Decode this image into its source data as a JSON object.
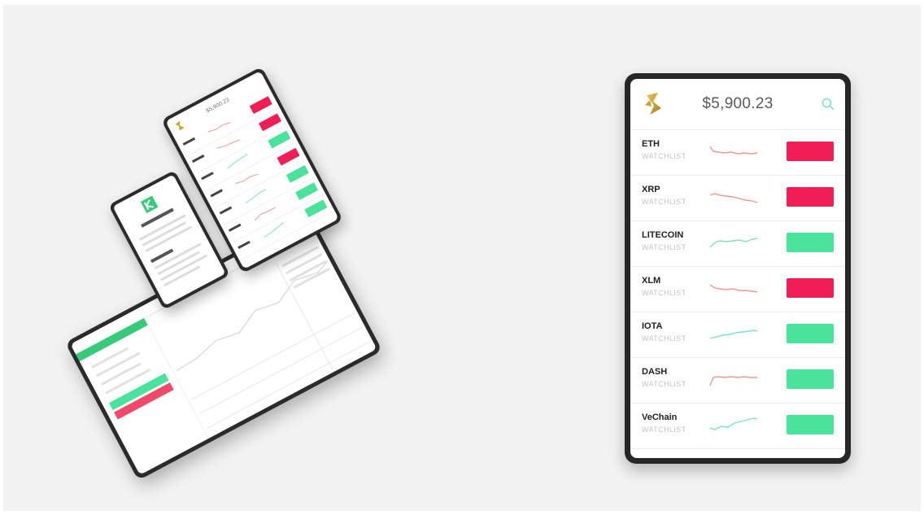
{
  "phone": {
    "balance": "$5,900.23",
    "logo_icon": "gold-coin-logo-icon",
    "search_icon": "search-icon",
    "coins": [
      {
        "name": "ETH",
        "sub": "WATCHLIST",
        "trend": "down"
      },
      {
        "name": "XRP",
        "sub": "WATCHLIST",
        "trend": "down"
      },
      {
        "name": "LITECOIN",
        "sub": "WATCHLIST",
        "trend": "up"
      },
      {
        "name": "XLM",
        "sub": "WATCHLIST",
        "trend": "down"
      },
      {
        "name": "IOTA",
        "sub": "WATCHLIST",
        "trend": "up"
      },
      {
        "name": "DASH",
        "sub": "WATCHLIST",
        "trend": "down"
      },
      {
        "name": "VeChain",
        "sub": "WATCHLIST",
        "trend": "up"
      }
    ]
  },
  "colors": {
    "down": "#ef1f55",
    "up": "#4be39b",
    "spark_down": "#e89a95",
    "spark_up": "#7fe0bf",
    "gold": "#c9a227"
  }
}
